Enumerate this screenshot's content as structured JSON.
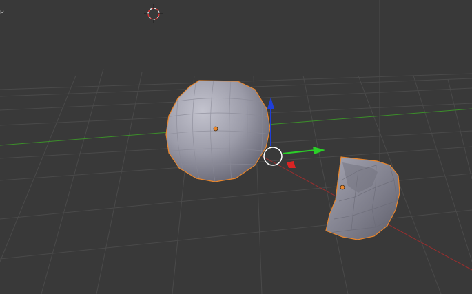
{
  "app": {
    "name": "3D Viewport",
    "corner_text": "p"
  },
  "colors": {
    "background": "#393939",
    "grid": "#4a4a4a",
    "x_axis": "#9b2e2e",
    "y_axis": "#3c8f2a",
    "selection_outline": "#e9862c",
    "origin_dot": "#e9862c",
    "mesh_light": "#b8b8c4",
    "mesh_dark": "#6c6c78",
    "gizmo_z": "#1f3fd9",
    "gizmo_y": "#2bcf28",
    "gizmo_x": "#d92424",
    "cursor_red": "#d83030",
    "cursor_white": "#e6e6e6"
  },
  "scene": {
    "objects": [
      {
        "name": "sphere",
        "type": "uv-sphere",
        "selected": true
      },
      {
        "name": "sphere-fragment",
        "type": "mesh-fragment",
        "selected": true
      }
    ],
    "gizmo": {
      "mode": "translate",
      "axes": [
        "x",
        "y",
        "z"
      ]
    },
    "cursor_3d": {
      "icon": "crosshair-icon"
    }
  }
}
